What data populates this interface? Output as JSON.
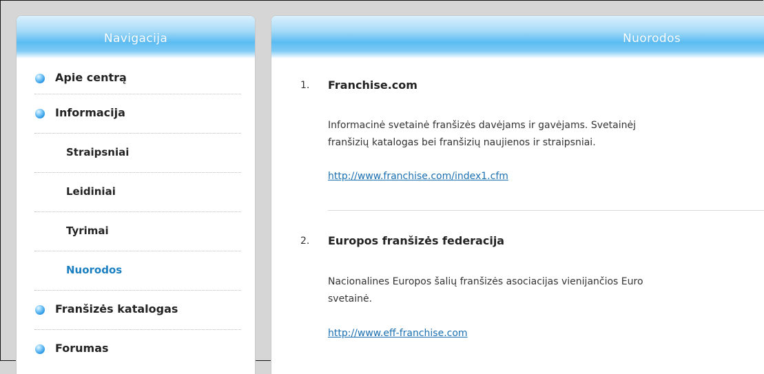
{
  "sidebar": {
    "title": "Navigacija",
    "items": [
      {
        "label": "Apie centrą",
        "level": "top"
      },
      {
        "label": "Informacija",
        "level": "top"
      },
      {
        "label": "Straipsniai",
        "level": "sub"
      },
      {
        "label": "Leidiniai",
        "level": "sub"
      },
      {
        "label": "Tyrimai",
        "level": "sub"
      },
      {
        "label": "Nuorodos",
        "level": "sub",
        "active": true
      },
      {
        "label": "Franšizės katalogas",
        "level": "top"
      },
      {
        "label": "Forumas",
        "level": "top"
      }
    ]
  },
  "content": {
    "title": "Nuorodos",
    "links": [
      {
        "number": "1.",
        "title": "Franchise.com",
        "description_line1": "Informacinė svetainė franšizės davėjams ir gavėjams. Svetainėj",
        "description_line2": "franšizių katalogas bei franšizių naujienos ir straipsniai.",
        "url": "http://www.franchise.com/index1.cfm"
      },
      {
        "number": "2.",
        "title": "Europos franšizės federacija",
        "description_line1": "Nacionalines Europos šalių franšizės asociacijas vienijančios Euro",
        "description_line2": "svetainė.",
        "url": "http://www.eff-franchise.com"
      }
    ]
  },
  "colors": {
    "accent": "#1a7fc0",
    "link": "#1a6fb0",
    "header_blue": "#5bbcf2",
    "background": "#d6d6d6"
  }
}
